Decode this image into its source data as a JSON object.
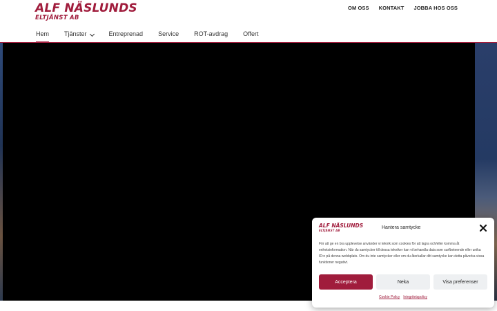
{
  "logo": {
    "main": "ALF NÄSLUNDS",
    "sub": "ELTJÄNST AB"
  },
  "top_links": [
    "OM OSS",
    "KONTAKT",
    "JOBBA HOS OSS"
  ],
  "nav": {
    "items": [
      {
        "label": "Hem",
        "active": true
      },
      {
        "label": "Tjänster",
        "dropdown": true
      },
      {
        "label": "Entreprenad"
      },
      {
        "label": "Service"
      },
      {
        "label": "ROT-avdrag"
      },
      {
        "label": "Offert"
      }
    ]
  },
  "consent": {
    "logo_main": "ALF NÄSLUNDS",
    "logo_sub": "ELTJÄNST AB",
    "title": "Hantera samtycke",
    "text": "För att ge en bra upplevelse använder vi teknik som cookies för att lagra och/eller komma åt enhetsinformation. När du samtycker till dessa tekniker kan vi behandla data som surfbeteende eller unika ID:n på denna webbplats. Om du inte samtycker eller om du återkallar ditt samtycke kan detta påverka vissa funktioner negativt.",
    "accept_label": "Acceptera",
    "deny_label": "Neka",
    "prefs_label": "Visa preferenser",
    "cookie_policy": "Cookie Policy",
    "privacy_policy": "Integritetspolicy"
  },
  "colors": {
    "brand": "#a01c3c",
    "button_secondary": "#eef0f2"
  }
}
